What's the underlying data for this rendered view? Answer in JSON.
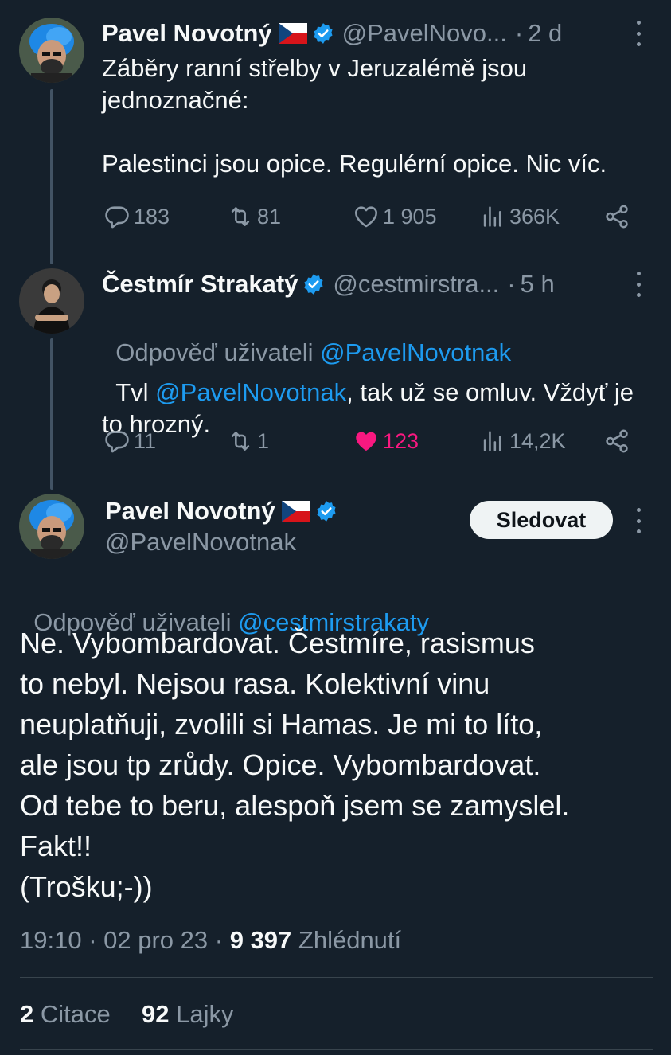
{
  "tweet1": {
    "name": "Pavel Novotný",
    "handle": "@PavelNovo...",
    "dot": "·",
    "time": "2 d",
    "text": "Záběry ranní střelby v Jeruzalémě jsou\njednoznačné:\n\nPalestinci jsou opice. Regulérní opice. Nic víc.",
    "replies": "183",
    "retweets": "81",
    "likes": "1 905",
    "views": "366K"
  },
  "tweet2": {
    "name": "Čestmír Strakatý",
    "handle": "@cestmirstra...",
    "dot": "·",
    "time": "5 h",
    "reply_to_prefix": "Odpověď uživateli ",
    "reply_to_handle": "@PavelNovotnak",
    "text_before": "Tvl ",
    "text_mention": "@PavelNovotnak",
    "text_after": ", tak už se omluv. Vždyť je\nto hrozný.",
    "replies": "11",
    "retweets": "1",
    "likes": "123",
    "views": "14,2K"
  },
  "main_tweet": {
    "name": "Pavel Novotný",
    "handle": "@PavelNovotnak",
    "follow_label": "Sledovat",
    "reply_to_prefix": "Odpověď uživateli ",
    "reply_to_handle": "@cestmirstrakaty",
    "text": "Ne. Vybombardovat. Čestmíre, rasismus\nto nebyl. Nejsou rasa. Kolektivní vinu\nneuplatňuji, zvolili si Hamas. Je mi to líto,\nale jsou tp zrůdy. Opice. Vybombardovat.\nOd tebe to beru, alespoň jsem se zamyslel.\nFakt!!\n(Trošku;-))",
    "time": "19:10",
    "sep1": " · ",
    "date": "02 pro 23",
    "sep2": " · ",
    "views_count": "9 397",
    "views_label": " Zhlédnutí",
    "quotes_count": "2",
    "quotes_label": " Citace",
    "likes_count": "92",
    "likes_label": " Lajky"
  },
  "colors": {
    "background": "#15202b",
    "link": "#1d9bf0",
    "like_active": "#f91880",
    "muted": "#8b98a5"
  },
  "icons": [
    "reply-icon",
    "retweet-icon",
    "heart-icon",
    "views-icon",
    "share-icon",
    "verified-badge-icon",
    "czech-flag-icon",
    "more-icon"
  ]
}
